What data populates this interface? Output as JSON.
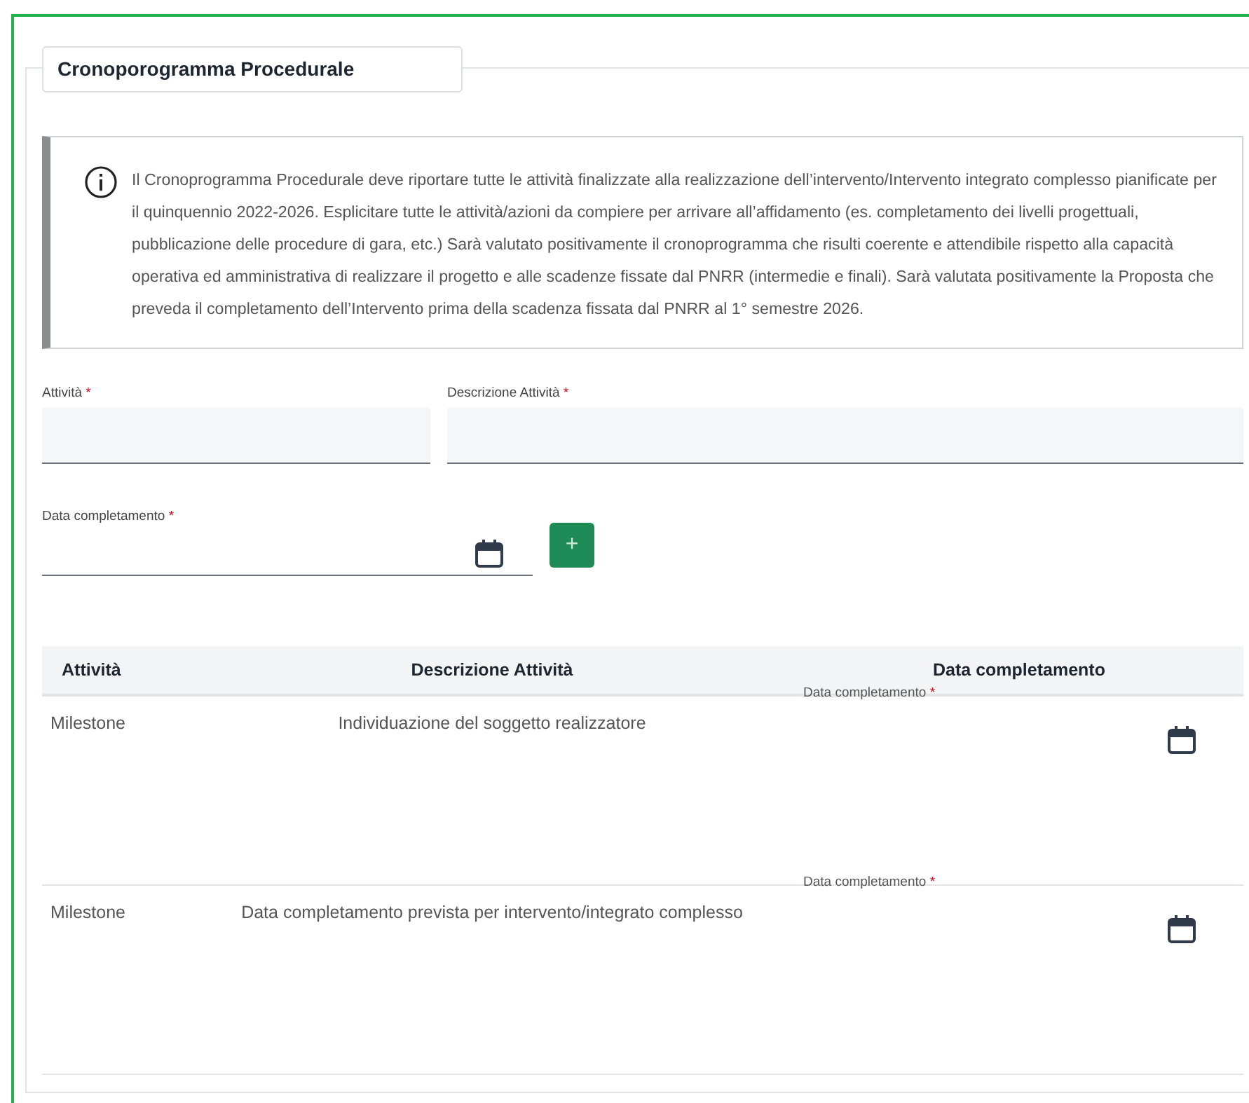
{
  "section": {
    "title": "Cronoporogramma Procedurale"
  },
  "info": {
    "text": "Il Cronoprogramma Procedurale deve riportare tutte le attività finalizzate alla realizzazione dell’intervento/Intervento integrato complesso pianificate per il quinquennio 2022-2026. Esplicitare tutte le attività/azioni da compiere per arrivare all’affidamento (es. completamento dei livelli progettuali, pubblicazione delle procedure di gara, etc.) Sarà valutato positivamente il cronoprogramma che risulti coerente e attendibile rispetto alla capacità operativa ed amministrativa di realizzare il progetto e alle scadenze fissate dal PNRR (intermedie e finali). Sarà valutata positivamente la Proposta che preveda il completamento dell’Intervento prima della scadenza fissata dal PNRR al 1° semestre 2026."
  },
  "form": {
    "fields": [
      {
        "kind": "text",
        "label": "Attività",
        "required_mark": "*"
      },
      {
        "kind": "text",
        "label": "Descrizione Attività",
        "required_mark": "*"
      },
      {
        "kind": "date",
        "label": "Data completamento",
        "required_mark": "*"
      }
    ],
    "add_button": "+"
  },
  "table": {
    "columns": [
      "Attività",
      "Descrizione Attività",
      "Data completamento"
    ],
    "rows": [
      {
        "activity": "Milestone",
        "description": "Individuazione del soggetto realizzatore",
        "date_label": "Data completamento",
        "required_mark": "*"
      },
      {
        "activity": "Milestone",
        "description": "Data completamento prevista per intervento/integrato complesso",
        "date_label": "Data completamento",
        "required_mark": "*"
      }
    ]
  }
}
